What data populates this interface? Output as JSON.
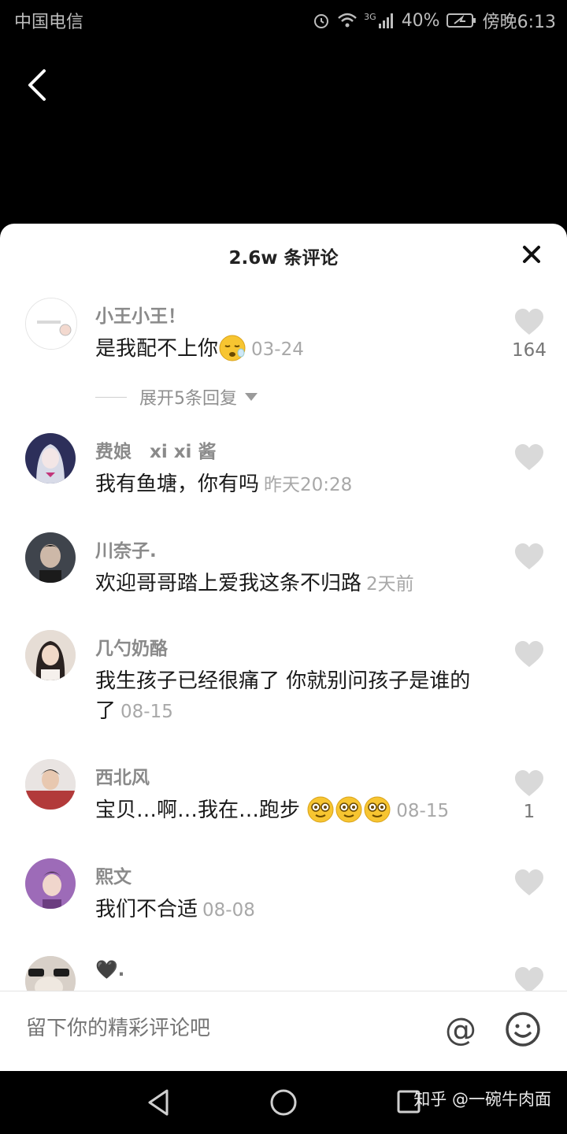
{
  "status_bar": {
    "carrier": "中国电信",
    "network": "3G",
    "battery": "40%",
    "time": "傍晚6:13"
  },
  "sheet": {
    "title": "2.6w 条评论"
  },
  "comments": [
    {
      "username": "小王小王！",
      "text": "是我配不上你",
      "emoji": "sleepy-face",
      "time": "03-24",
      "likes": "164",
      "avatar_color": "#ffffff"
    },
    {
      "username": "费娘　xi xi 酱",
      "text": "我有鱼塘，你有吗",
      "time": "昨天20:28",
      "likes": "",
      "avatar_color": "#3a3c6a"
    },
    {
      "username": "川奈子.",
      "text": "欢迎哥哥踏上爱我这条不归路",
      "time": "2天前",
      "likes": "",
      "avatar_color": "#4a4f58"
    },
    {
      "username": "几勺奶酪",
      "text": "我生孩子已经很痛了 你就别问孩子是谁的了",
      "time": "08-15",
      "likes": "",
      "avatar_color": "#c9b8ab"
    },
    {
      "username": "西北风",
      "text": "宝贝…啊…我在…跑步",
      "emoji": "dizzy-face x3",
      "time": "08-15",
      "likes": "1",
      "avatar_color": "#b84848"
    },
    {
      "username": "熙文",
      "text": "我们不合适",
      "time": "08-08",
      "likes": "",
      "avatar_color": "#8a5fa0"
    },
    {
      "username": "🖤.",
      "text": "",
      "time": "",
      "likes": "",
      "avatar_color": "#cfc7bf"
    }
  ],
  "replies": {
    "expand_label": "展开5条回复"
  },
  "input": {
    "placeholder": "留下你的精彩评论吧",
    "at_label": "@"
  },
  "watermark": "知乎 @一碗牛肉面",
  "colors": {
    "background": "#000000",
    "sheet": "#ffffff",
    "username": "#8a8a8a",
    "timestamp": "#a8a8a8",
    "heart": "#d9d9d9"
  }
}
